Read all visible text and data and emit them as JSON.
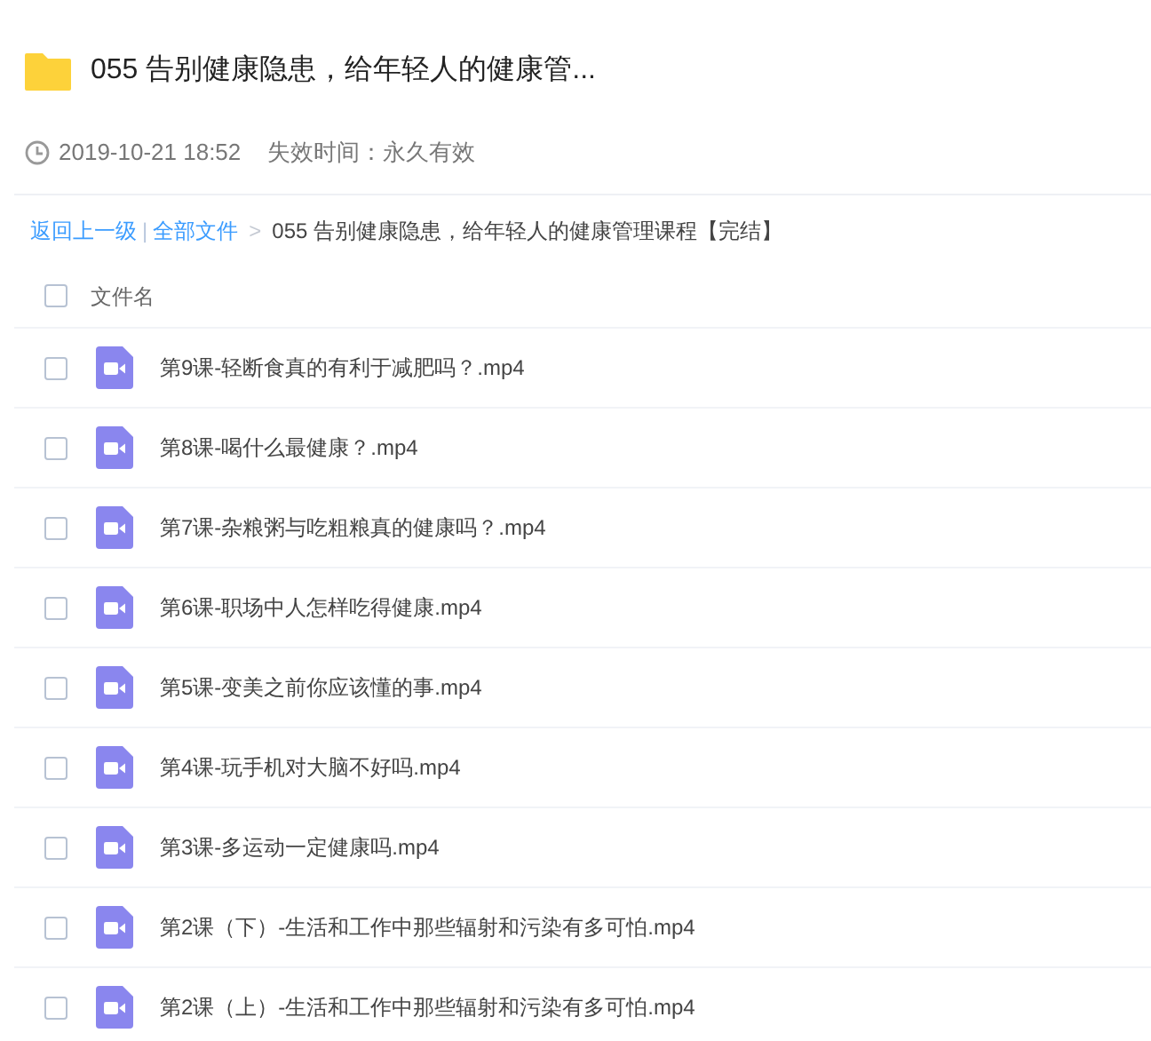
{
  "title": "055 告别健康隐患，给年轻人的健康管...",
  "meta": {
    "date": "2019-10-21 18:52",
    "expiry": "失效时间：永久有效"
  },
  "breadcrumb": {
    "back": "返回上一级",
    "separator": "|",
    "root": "全部文件",
    "arrow": ">",
    "current": "055 告别健康隐患，给年轻人的健康管理课程【完结】"
  },
  "table": {
    "columns": [
      "文件名"
    ],
    "select_all_checked": false,
    "rows": [
      {
        "name": "第9课-轻断食真的有利于减肥吗？.mp4",
        "checked": false
      },
      {
        "name": "第8课-喝什么最健康？.mp4",
        "checked": false
      },
      {
        "name": "第7课-杂粮粥与吃粗粮真的健康吗？.mp4",
        "checked": false
      },
      {
        "name": "第6课-职场中人怎样吃得健康.mp4",
        "checked": false
      },
      {
        "name": "第5课-变美之前你应该懂的事.mp4",
        "checked": false
      },
      {
        "name": "第4课-玩手机对大脑不好吗.mp4",
        "checked": false
      },
      {
        "name": "第3课-多运动一定健康吗.mp4",
        "checked": false
      },
      {
        "name": "第2课（下）-生活和工作中那些辐射和污染有多可怕.mp4",
        "checked": false
      },
      {
        "name": "第2课（上）-生活和工作中那些辐射和污染有多可怕.mp4",
        "checked": false
      }
    ]
  }
}
